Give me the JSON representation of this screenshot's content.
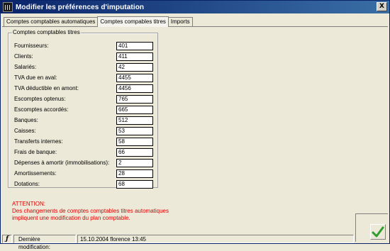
{
  "window": {
    "title": "Modifier les préférences d'imputation",
    "close_glyph": "X"
  },
  "tabs": [
    {
      "label": "Comptes comptables automatiques",
      "active": false
    },
    {
      "label": "Comptes compables titres",
      "active": true
    },
    {
      "label": "Imports",
      "active": false
    }
  ],
  "group": {
    "title": "Comptes comptables titres",
    "rows": [
      {
        "label": "Fournisseurs:",
        "value": "401"
      },
      {
        "label": "Clients:",
        "value": "411"
      },
      {
        "label": "Salariés:",
        "value": "42"
      },
      {
        "label": "TVA due en aval:",
        "value": "4455"
      },
      {
        "label": "TVA déductible en amont:",
        "value": "4456"
      },
      {
        "label": "Escomptes optenus:",
        "value": "765"
      },
      {
        "label": "Escomptes accordés:",
        "value": "665"
      },
      {
        "label": "Banques:",
        "value": "512"
      },
      {
        "label": "Caisses:",
        "value": "53"
      },
      {
        "label": "Transferts internes:",
        "value": "58"
      },
      {
        "label": "Frais de banque:",
        "value": "66"
      },
      {
        "label": "Dépenses à amortir (immobilisations):",
        "value": "2"
      },
      {
        "label": "Amortissements:",
        "value": "28"
      },
      {
        "label": "Dotations:",
        "value": "68"
      }
    ]
  },
  "warning": {
    "title": "ATTENTION:",
    "body": "Des changements de comptes comptables titres automatiques impliquent une modification du plan comptable."
  },
  "status": {
    "icon_glyph": "ƒ",
    "label": "Dernière modification:",
    "value": "15.10.2004 florence 13:45"
  },
  "colors": {
    "warning": "#e00000",
    "ok_check": "#2e9e2e",
    "titlebar": "#0a246a"
  },
  "icons": {
    "app": "app-icon",
    "close": "close-icon",
    "ok": "checkmark-icon",
    "status": "function-icon"
  }
}
